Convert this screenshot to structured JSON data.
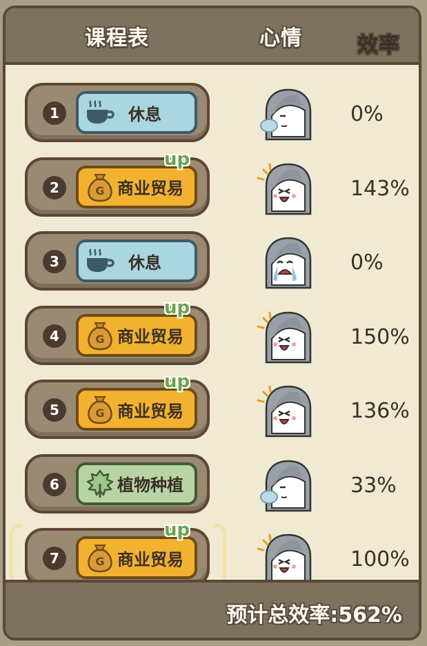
{
  "header": {
    "schedule_label": "课程表",
    "mood_label": "心情",
    "efficiency_label": "效率"
  },
  "rows": [
    {
      "num": "1",
      "course": "休息",
      "type": "rest",
      "up": "",
      "mood": "sleepy",
      "efficiency": "0%"
    },
    {
      "num": "2",
      "course": "商业贸易",
      "type": "trade",
      "up": "up",
      "mood": "happy",
      "efficiency": "143%"
    },
    {
      "num": "3",
      "course": "休息",
      "type": "rest",
      "up": "",
      "mood": "crying",
      "efficiency": "0%"
    },
    {
      "num": "4",
      "course": "商业贸易",
      "type": "trade",
      "up": "up",
      "mood": "happy",
      "efficiency": "150%"
    },
    {
      "num": "5",
      "course": "商业贸易",
      "type": "trade",
      "up": "up",
      "mood": "happy",
      "efficiency": "136%"
    },
    {
      "num": "6",
      "course": "植物种植",
      "type": "plant",
      "up": "",
      "mood": "sleepy",
      "efficiency": "33%"
    },
    {
      "num": "7",
      "course": "商业贸易",
      "type": "trade",
      "up": "up",
      "mood": "happy",
      "efficiency": "100%",
      "selected": true
    }
  ],
  "footer": {
    "total_label": "预计总效率:562%"
  },
  "colors": {
    "rest": "#a9d6e0",
    "trade": "#f2b22f",
    "plant": "#b8d4a4",
    "up": "#6ea34a"
  }
}
